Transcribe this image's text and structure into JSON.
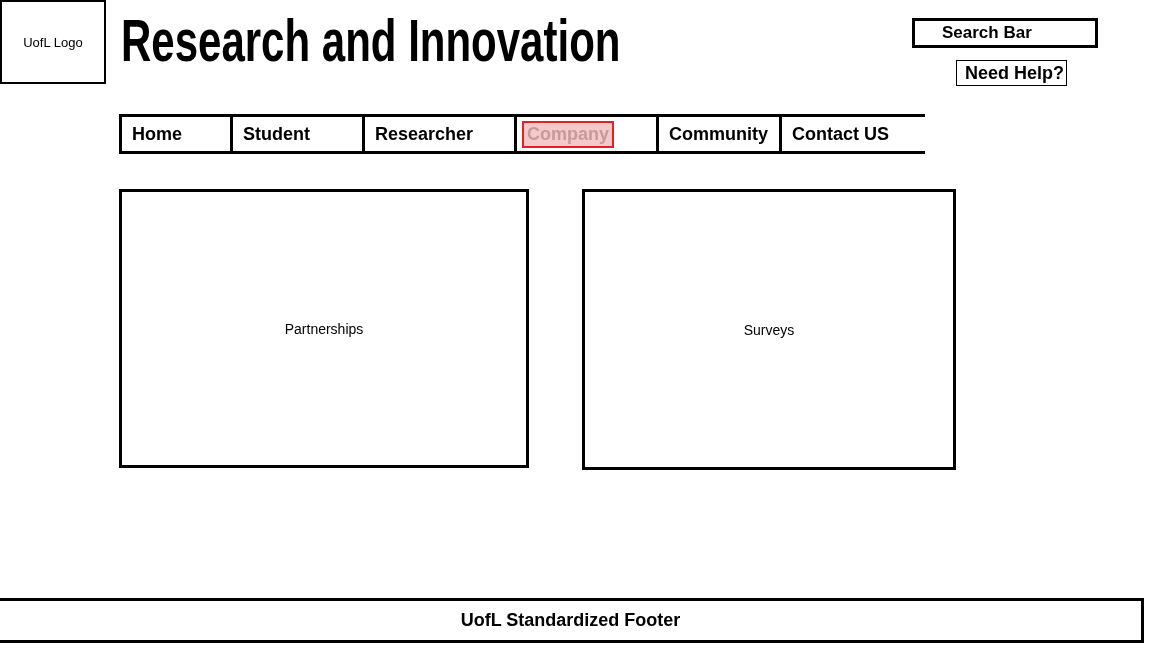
{
  "logo": {
    "label": "UofL Logo"
  },
  "title": "Research and Innovation",
  "search": {
    "placeholder": "Search Bar"
  },
  "help_button": {
    "label": "Need Help?"
  },
  "nav": [
    {
      "label": "Home",
      "selected": false
    },
    {
      "label": "Student",
      "selected": false
    },
    {
      "label": "Researcher",
      "selected": false
    },
    {
      "label": "Company",
      "selected": true
    },
    {
      "label": "Community",
      "selected": false
    },
    {
      "label": "Contact US",
      "selected": false
    }
  ],
  "panels": [
    {
      "label": "Partnerships"
    },
    {
      "label": "Surveys"
    }
  ],
  "footer": {
    "label": "UofL Standardized Footer"
  }
}
